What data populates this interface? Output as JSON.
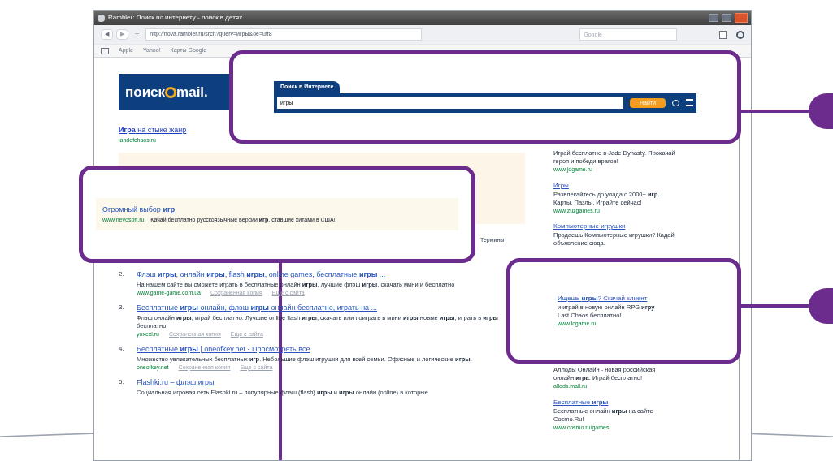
{
  "window": {
    "title": "Rambler: Поиск по интернету - поиск в детях"
  },
  "toolbar": {
    "back": "◀",
    "forward": "▶",
    "add": "+",
    "url": "http://nova.rambler.ru/srch?query=игры&oe=utf8",
    "search_placeholder": "Google"
  },
  "bookmarks": [
    "Apple",
    "Yahoo!",
    "Карты Google"
  ],
  "logo": {
    "left": "поиск",
    "right": "mail."
  },
  "top_ad": {
    "title": "**Игра** на стыке жанр",
    "url": "landofchaos.ru"
  },
  "terms": "Термины",
  "results": [
    {
      "number": "2.",
      "title": "Флэш **игры**, онлайн **игры**, flash **игры**, online games, бесплатные **игры** ...",
      "snippet": "На нашем сайте вы сможете играть в бесплатные онлайн **игры**, лучшие флэш **игры**, скачать мини и бесплатно",
      "url": "www.game-game.com.ua",
      "links": [
        "Сохраненная копия",
        "Еще с сайта"
      ]
    },
    {
      "number": "3.",
      "title": "Бесплатные **игры** онлайн, флэш **игры** онлайн бесплатно, играть на ...",
      "snippet": "Флэш онлайн **игры**, играй бесплатно. Лучшие online flash **игры**, скачать или поиграть в мини **игры** новые **игры**, играть в **игры** бесплатно",
      "url": "yoxexl.ru",
      "links": [
        "Сохраненная копия",
        "Еще с сайта"
      ]
    },
    {
      "number": "4.",
      "title": "Бесплатные **игры** | oneofkey.net - Просмотреть все",
      "snippet": "Множество увлекательных бесплатных **игр**. Небольшие флэш игрушки для всей семьи. Офисные и логические **игры**.",
      "url": "oneofkey.net",
      "links": [
        "Сохраненная копия",
        "Еще с сайта"
      ]
    },
    {
      "number": "5.",
      "title": "Flashki.ru – флэш игры",
      "snippet": "Социальная игровая сеть Flashki.ru – популярные флэш (flash) **игры** и **игры** онлайн (online) в которые"
    }
  ],
  "side_ads": [
    {
      "text": "Играй бесплатно в Jade Dynasty. Прокачай героя и победи врагов!",
      "url": "www.jdgame.ru"
    },
    {
      "title": "Игры",
      "text": "Развлекайтесь до упада с 2000+ **игр**. Карты, Пазлы. Играйте сейчас!",
      "url": "www.zuzgames.ru"
    },
    {
      "title": "Компьютерные игрушки",
      "text": "Продаешь Компьютерные игрушки? Кадай объявление сюда."
    },
    {
      "text": "Аллоды Онлайн - новая российская онлайн **игра**. Играй бесплатно!",
      "url": "allods.mail.ru"
    },
    {
      "title": "Бесплатные **игры**",
      "text": "Бесплатные онлайн **игры** на сайте Cosmo.Ru!",
      "url": "www.cosmo.ru/games"
    }
  ],
  "callouts": [
    {
      "kind": "search",
      "tab": "Поиск в Интернете",
      "value": "игры",
      "button": "Найти"
    },
    {
      "kind": "ad",
      "title": "Огромный выбор **игр**",
      "url": "www.nevosoft.ru",
      "text": "Качай бесплатно русскоязычные версии **игр**, ставшие хитами в США!"
    },
    {
      "kind": "side_ad",
      "title": "Ищешь **игры**? Скачай клиент",
      "text": "и играй в новую онлайн RPG **игру** Last Chaos бесплатно!",
      "url": "www.lcgame.ru"
    }
  ]
}
